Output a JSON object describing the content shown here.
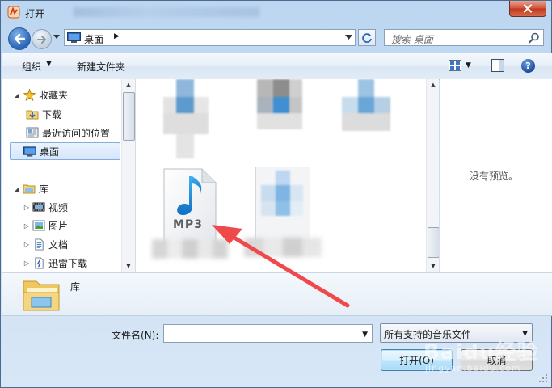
{
  "window": {
    "title": "打开",
    "close_icon": "close-icon"
  },
  "nav": {
    "address_crumb": "桌面",
    "search_placeholder": "搜索 桌面"
  },
  "toolbar": {
    "organize_label": "组织",
    "new_folder_label": "新建文件夹"
  },
  "navpane": {
    "items": [
      {
        "label": "收藏夹",
        "icon": "star-icon"
      },
      {
        "label": "下载",
        "icon": "download-folder-icon"
      },
      {
        "label": "最近访问的位置",
        "icon": "recent-places-icon"
      },
      {
        "label": "桌面",
        "icon": "desktop-icon",
        "selected": true
      },
      {
        "label": "库",
        "icon": "library-icon"
      },
      {
        "label": "视频",
        "icon": "video-icon"
      },
      {
        "label": "图片",
        "icon": "pictures-icon"
      },
      {
        "label": "文档",
        "icon": "documents-icon"
      },
      {
        "label": "迅雷下载",
        "icon": "thunder-download-icon"
      }
    ]
  },
  "filelist": {
    "mp3_badge": "MP3"
  },
  "preview": {
    "text": "没有预览。"
  },
  "details": {
    "name": "库"
  },
  "bottom": {
    "filename_label": "文件名(N):",
    "filename_value": "",
    "filter_value": "所有支持的音乐文件",
    "open_label": "打开(O)",
    "cancel_label": "取消"
  },
  "watermark": {
    "main": "Baidu经验",
    "sub": "jingyan.baidu.com"
  },
  "colors": {
    "accent": "#2a66b8",
    "arrow": "#f0494b"
  }
}
